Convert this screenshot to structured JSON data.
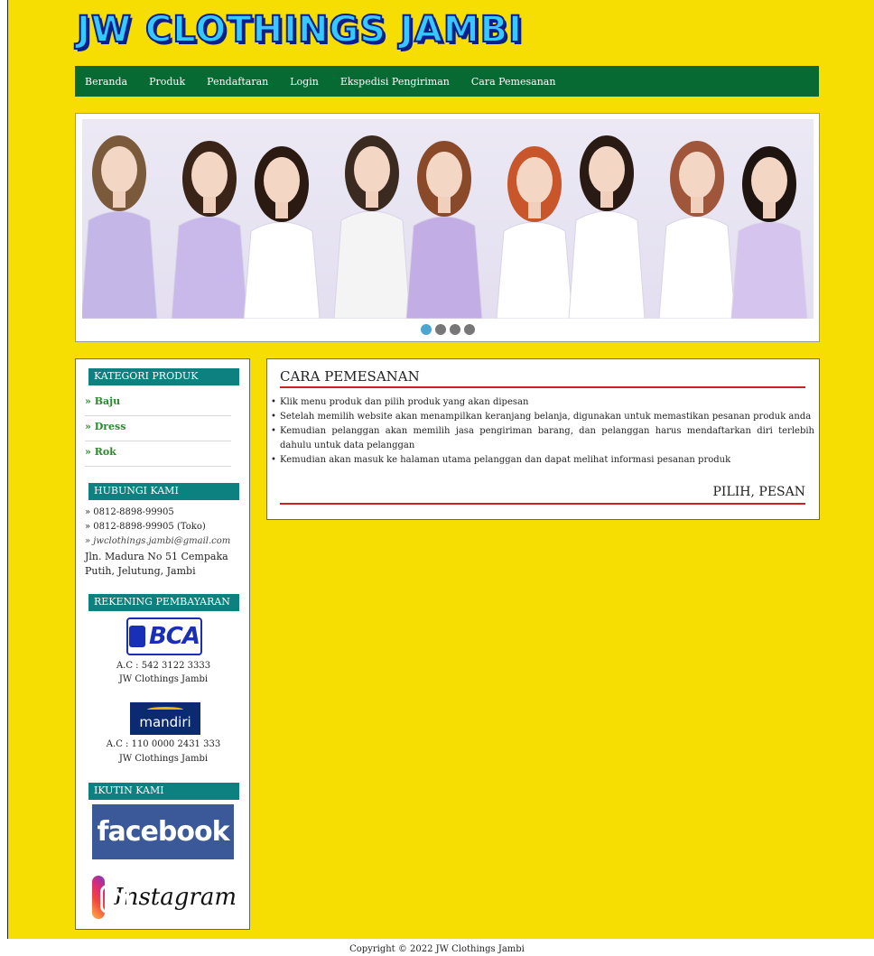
{
  "site": {
    "logo_text": "JW CLOTHINGS JAMBI"
  },
  "nav": {
    "items": [
      "Beranda",
      "Produk",
      "Pendaftaran",
      "Login",
      "Ekspedisi Pengiriman",
      "Cara Pemesanan"
    ]
  },
  "slider": {
    "dot_count": 4,
    "active_dot": 1
  },
  "sidebar": {
    "kategori_heading": "KATEGORI PRODUK",
    "categories": [
      "» Baju",
      "» Dress",
      "» Rok"
    ],
    "hubungi_heading": "HUBUNGI KAMI",
    "contact": {
      "phone1": "» 0812-8898-99905",
      "phone2": "» 0812-8898-99905 (Toko)",
      "email": "» jwclothings.jambi@gmail.com",
      "address_line1": "Jln. Madura No 51 Cempaka",
      "address_line2": "Putih, Jelutung, Jambi"
    },
    "rekening_heading": "REKENING PEMBAYARAN",
    "banks": [
      {
        "logo": "BCA",
        "account": "A.C : 542 3122 3333",
        "holder": "JW Clothings Jambi"
      },
      {
        "logo": "mandiri",
        "account": "A.C : 110 0000 2431 333",
        "holder": "JW Clothings Jambi"
      }
    ],
    "ikutin_heading": "IKUTIN KAMI",
    "social": {
      "facebook": "facebook",
      "instagram": "Instagram"
    }
  },
  "content": {
    "title": "CARA PEMESANAN",
    "steps": [
      "Klik menu produk dan pilih produk yang akan dipesan",
      "Setelah memilih website akan menampilkan keranjang belanja, digunakan untuk memastikan pesanan produk anda",
      "Kemudian pelanggan akan memilih jasa pengiriman barang, dan pelanggan harus mendaftarkan diri terlebih dahulu untuk data pelanggan",
      "Kemudian akan masuk ke halaman utama pelanggan dan dapat melihat informasi pesanan produk"
    ],
    "footer_heading": "PILIH, PESAN"
  },
  "footer": {
    "copyright": "Copyright © 2022 JW Clothings Jambi"
  },
  "colors": {
    "page_bg": "#f6dd02",
    "nav_bg": "#066a32",
    "heading_bg": "#0d8080",
    "accent_red": "#cc2222",
    "category_green": "#2b8a2b"
  }
}
